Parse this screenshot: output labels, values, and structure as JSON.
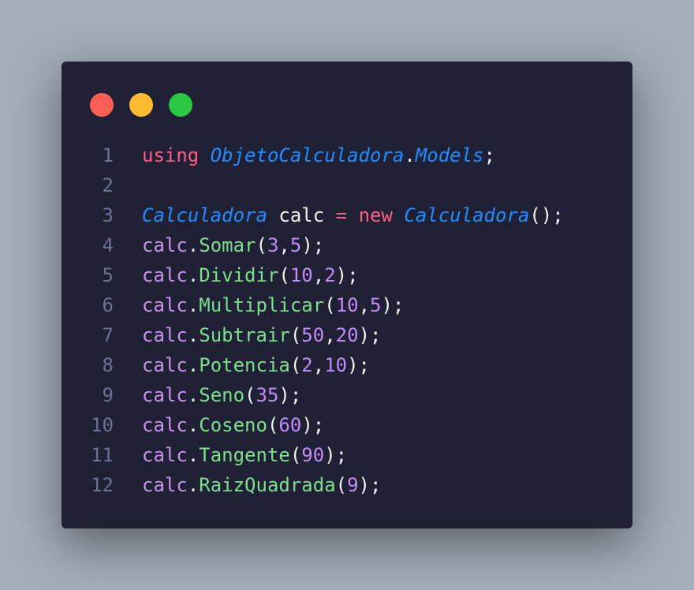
{
  "window": {
    "buttons": {
      "close_color": "#ff5f57",
      "minimize_color": "#febc2e",
      "maximize_color": "#28c840"
    }
  },
  "code": {
    "lines": [
      {
        "n": "1",
        "tokens": [
          [
            "kw",
            "using"
          ],
          [
            "pl",
            " "
          ],
          [
            "ty",
            "ObjetoCalculadora"
          ],
          [
            "pl",
            "."
          ],
          [
            "ty",
            "Models"
          ],
          [
            "pl",
            ";"
          ]
        ]
      },
      {
        "n": "2",
        "tokens": []
      },
      {
        "n": "3",
        "tokens": [
          [
            "ty",
            "Calculadora"
          ],
          [
            "pl",
            " calc "
          ],
          [
            "op",
            "="
          ],
          [
            "pl",
            " "
          ],
          [
            "kw",
            "new"
          ],
          [
            "pl",
            " "
          ],
          [
            "ty",
            "Calculadora"
          ],
          [
            "pl",
            "();"
          ]
        ]
      },
      {
        "n": "4",
        "tokens": [
          [
            "var",
            "calc"
          ],
          [
            "pl",
            "."
          ],
          [
            "fn",
            "Somar"
          ],
          [
            "pl",
            "("
          ],
          [
            "num",
            "3"
          ],
          [
            "pl",
            ","
          ],
          [
            "num",
            "5"
          ],
          [
            "pl",
            ");"
          ]
        ]
      },
      {
        "n": "5",
        "tokens": [
          [
            "var",
            "calc"
          ],
          [
            "pl",
            "."
          ],
          [
            "fn",
            "Dividir"
          ],
          [
            "pl",
            "("
          ],
          [
            "num",
            "10"
          ],
          [
            "pl",
            ","
          ],
          [
            "num",
            "2"
          ],
          [
            "pl",
            ");"
          ]
        ]
      },
      {
        "n": "6",
        "tokens": [
          [
            "var",
            "calc"
          ],
          [
            "pl",
            "."
          ],
          [
            "fn",
            "Multiplicar"
          ],
          [
            "pl",
            "("
          ],
          [
            "num",
            "10"
          ],
          [
            "pl",
            ","
          ],
          [
            "num",
            "5"
          ],
          [
            "pl",
            ");"
          ]
        ]
      },
      {
        "n": "7",
        "tokens": [
          [
            "var",
            "calc"
          ],
          [
            "pl",
            "."
          ],
          [
            "fn",
            "Subtrair"
          ],
          [
            "pl",
            "("
          ],
          [
            "num",
            "50"
          ],
          [
            "pl",
            ","
          ],
          [
            "num",
            "20"
          ],
          [
            "pl",
            ");"
          ]
        ]
      },
      {
        "n": "8",
        "tokens": [
          [
            "var",
            "calc"
          ],
          [
            "pl",
            "."
          ],
          [
            "fn",
            "Potencia"
          ],
          [
            "pl",
            "("
          ],
          [
            "num",
            "2"
          ],
          [
            "pl",
            ","
          ],
          [
            "num",
            "10"
          ],
          [
            "pl",
            ");"
          ]
        ]
      },
      {
        "n": "9",
        "tokens": [
          [
            "var",
            "calc"
          ],
          [
            "pl",
            "."
          ],
          [
            "fn",
            "Seno"
          ],
          [
            "pl",
            "("
          ],
          [
            "num",
            "35"
          ],
          [
            "pl",
            ");"
          ]
        ]
      },
      {
        "n": "10",
        "tokens": [
          [
            "var",
            "calc"
          ],
          [
            "pl",
            "."
          ],
          [
            "fn",
            "Coseno"
          ],
          [
            "pl",
            "("
          ],
          [
            "num",
            "60"
          ],
          [
            "pl",
            ");"
          ]
        ]
      },
      {
        "n": "11",
        "tokens": [
          [
            "var",
            "calc"
          ],
          [
            "pl",
            "."
          ],
          [
            "fn",
            "Tangente"
          ],
          [
            "pl",
            "("
          ],
          [
            "num",
            "90"
          ],
          [
            "pl",
            ");"
          ]
        ]
      },
      {
        "n": "12",
        "tokens": [
          [
            "var",
            "calc"
          ],
          [
            "pl",
            "."
          ],
          [
            "fn",
            "RaizQuadrada"
          ],
          [
            "pl",
            "("
          ],
          [
            "num",
            "9"
          ],
          [
            "pl",
            ");"
          ]
        ]
      }
    ]
  }
}
